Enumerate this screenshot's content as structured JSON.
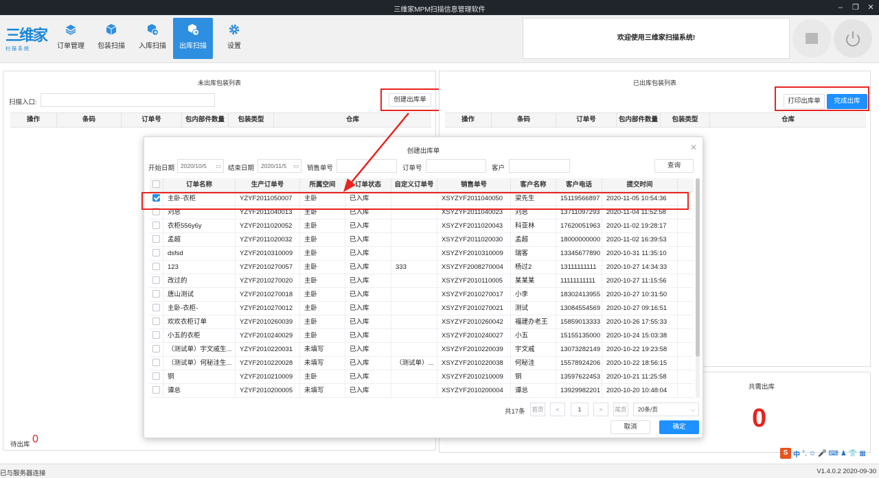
{
  "window": {
    "title": "三维家MPM扫描信息管理软件",
    "minimize": "–",
    "restore": "❐",
    "close": "✕"
  },
  "logo": {
    "main": "三维家",
    "sub": "扫描系统"
  },
  "nav": [
    {
      "label": "订单管理",
      "icon": "layers-icon"
    },
    {
      "label": "包装扫描",
      "icon": "box-icon"
    },
    {
      "label": "入库扫描",
      "icon": "box-in-icon"
    },
    {
      "label": "出库扫描",
      "icon": "box-out-icon"
    },
    {
      "label": "设置",
      "icon": "gear-icon"
    }
  ],
  "welcome": "欢迎使用三维家扫描系统!",
  "left_panel": {
    "title": "未出库包装列表",
    "scan_label": "扫描入口:",
    "create_button": "创建出库单",
    "columns": [
      "操作",
      "条码",
      "订单号",
      "包内部件数量",
      "包装类型",
      "仓库"
    ],
    "footer_label": "待出库",
    "footer_count": "0"
  },
  "right_panel": {
    "title": "已出库包装列表",
    "print_button": "打印出库单",
    "complete_button": "完成出库",
    "columns": [
      "操作",
      "条码",
      "订单号",
      "包内部件数量",
      "包装类型",
      "仓库"
    ],
    "total_label": "共需出库",
    "total_count": "0"
  },
  "dialog": {
    "title": "创建出库单",
    "close": "✕",
    "filters": {
      "start_label": "开始日期",
      "start_value": "2020/10/5",
      "end_label": "结束日期",
      "end_value": "2020/11/5",
      "sales_label": "销售单号",
      "order_label": "订单号",
      "customer_label": "客户",
      "query_button": "查询"
    },
    "columns": [
      "订单名称",
      "生产订单号",
      "所属空间",
      "订单状态",
      "自定义订单号",
      "销售单号",
      "客户名称",
      "客户电话",
      "提交时间"
    ],
    "rows": [
      {
        "checked": true,
        "cells": [
          "主卧-衣柜",
          "YZYF2011050007",
          "主卧",
          "已入库",
          "",
          "XSYZYF2011040050",
          "梁先生",
          "15119566897",
          "2020-11-05 10:54:36"
        ]
      },
      {
        "checked": false,
        "cells": [
          "刘总",
          "YZYF2011040013",
          "主卧",
          "已入库",
          "",
          "XSYZYF2011040023",
          "刘总",
          "13711097293",
          "2020-11-04 11:52:58"
        ]
      },
      {
        "checked": false,
        "cells": [
          "衣柜556y6y",
          "YZYF2011020052",
          "主卧",
          "已入库",
          "",
          "XSYZYF2011020043",
          "科亚林",
          "17620051963",
          "2020-11-02 19:28:17"
        ]
      },
      {
        "checked": false,
        "cells": [
          "孟超",
          "YZYF2011020032",
          "主卧",
          "已入库",
          "",
          "XSYZYF2011020030",
          "孟超",
          "18000000000",
          "2020-11-02 16:39:53"
        ]
      },
      {
        "checked": false,
        "cells": [
          "dsfsd",
          "YZYF2010310009",
          "主卧",
          "已入库",
          "",
          "XSYZYF2010310009",
          "瑞客",
          "13345677890",
          "2020-10-31 11:35:10"
        ]
      },
      {
        "checked": false,
        "cells": [
          "123",
          "YZYF2010270057",
          "主卧",
          "已入库",
          "333",
          "XSYZYF2008270004",
          "杨过2",
          "13111111111",
          "2020-10-27 14:34:33"
        ]
      },
      {
        "checked": false,
        "cells": [
          "改过的",
          "YZYF2010270020",
          "主卧",
          "已入库",
          "",
          "XSYZYF2010110005",
          "某某某",
          "11111111111",
          "2020-10-27 11:15:56"
        ]
      },
      {
        "checked": false,
        "cells": [
          "唐山测试",
          "YZYF2010270018",
          "主卧",
          "已入库",
          "",
          "XSYZYF2010270017",
          "小李",
          "18302413955",
          "2020-10-27 10:31:50"
        ]
      },
      {
        "checked": false,
        "cells": [
          "主卧-衣柜-",
          "YZYF2010270012",
          "主卧",
          "已入库",
          "",
          "XSYZYF2010270021",
          "测试",
          "13084554569",
          "2020-10-27 09:16:51"
        ]
      },
      {
        "checked": false,
        "cells": [
          "欢欢衣柜订单",
          "YZYF2010260039",
          "主卧",
          "已入库",
          "",
          "XSYZYF2010260042",
          "福建办老王",
          "15859013333",
          "2020-10-26 17:55:33"
        ]
      },
      {
        "checked": false,
        "cells": [
          "小五的衣柜",
          "YZYF2010240029",
          "主卧",
          "已入库",
          "",
          "XSYZYF2010240027",
          "小五",
          "15155135000",
          "2020-10-24 15:03:38"
        ]
      },
      {
        "checked": false,
        "cells": [
          "（测试单）宇文戚生...",
          "YZYF2010220031",
          "未填写",
          "已入库",
          "",
          "XSYZYF2010220039",
          "宇文戚",
          "13073282149",
          "2020-10-22 19:23:58"
        ]
      },
      {
        "checked": false,
        "cells": [
          "（测试单）何秘洼生...",
          "YZYF2010220028",
          "未填写",
          "已入库",
          "（测试单）...",
          "XSYZYF2010220038",
          "何秘洼",
          "15578924206",
          "2020-10-22 18:56:15"
        ]
      },
      {
        "checked": false,
        "cells": [
          "铜",
          "YZYF2010210009",
          "主卧",
          "已入库",
          "",
          "XSYZYF2010210009",
          "铜",
          "13597622453",
          "2020-10-21 11:25:58"
        ]
      },
      {
        "checked": false,
        "cells": [
          "谭总",
          "YZYF2010200005",
          "未填写",
          "已入库",
          "",
          "XSYZYF2010200004",
          "谭总",
          "13929982201",
          "2020-10-20 10:48:04"
        ]
      }
    ],
    "pagination": {
      "total": "共17条",
      "first": "首页",
      "prev": "<",
      "page": "1",
      "next": ">",
      "last": "尾页",
      "size": "20条/页"
    },
    "cancel_button": "取消",
    "confirm_button": "确定"
  },
  "status": {
    "left": "已与服务器连接",
    "version": "V1.4.0.2 2020-09-30"
  },
  "tray": [
    "S",
    "中",
    "°,",
    "☺",
    "🎤",
    "⌨",
    "♟",
    "👕",
    "▦"
  ],
  "colors": {
    "accent": "#2e8ee0",
    "highlight": "#e8231f",
    "titlebar": "#20252c"
  }
}
